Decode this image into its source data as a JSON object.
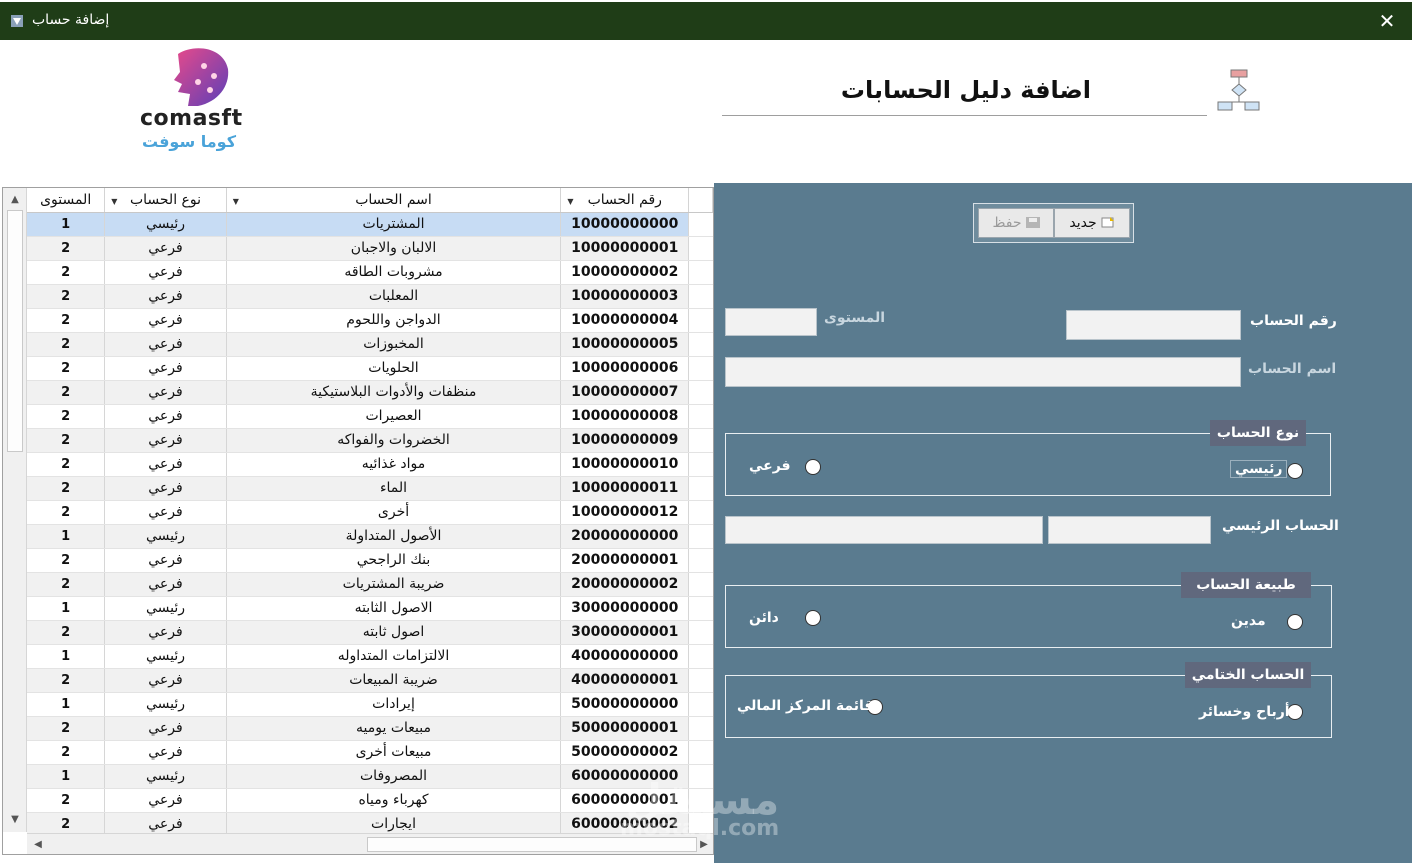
{
  "window": {
    "title": "إضافة حساب",
    "close_glyph": "✕"
  },
  "header": {
    "title": "اضافة دليل الحسابات",
    "logo_en": "comasft",
    "logo_ar": "كوما سوفت"
  },
  "toolbar": {
    "new_label": "جديد",
    "save_label": "حفظ"
  },
  "form": {
    "account_number_label": "رقم الحساب",
    "account_name_label": "اسم الحساب",
    "level_label": "المستوى",
    "account_number_value": "",
    "account_name_value": "",
    "level_value": "",
    "account_type": {
      "legend": "نوع الحساب",
      "option_main": "رئيسي",
      "option_sub": "فرعي"
    },
    "parent_account_label": "الحساب الرئيسي",
    "parent_account_code": "",
    "parent_account_name": "",
    "nature": {
      "legend": "طبيعة الحساب",
      "option_debit": "مدين",
      "option_credit": "دائن"
    },
    "final_account": {
      "legend": "الحساب الختامي",
      "option_pl": "أرباح وخسائر",
      "option_bs": "قائمة المركز المالي"
    }
  },
  "grid": {
    "columns": {
      "level": "المستوى",
      "type": "نوع الحساب",
      "name": "اسم الحساب",
      "number": "رقم الحساب"
    },
    "rows": [
      {
        "level": "1",
        "type": "رئيسي",
        "name": "المشتريات",
        "number": "10000000000"
      },
      {
        "level": "2",
        "type": "فرعي",
        "name": "الالبان والاجبان",
        "number": "10000000001"
      },
      {
        "level": "2",
        "type": "فرعي",
        "name": "مشروبات الطاقه",
        "number": "10000000002"
      },
      {
        "level": "2",
        "type": "فرعي",
        "name": "المعلبات",
        "number": "10000000003"
      },
      {
        "level": "2",
        "type": "فرعي",
        "name": "الدواجن واللحوم",
        "number": "10000000004"
      },
      {
        "level": "2",
        "type": "فرعي",
        "name": "المخبوزات",
        "number": "10000000005"
      },
      {
        "level": "2",
        "type": "فرعي",
        "name": "الحلويات",
        "number": "10000000006"
      },
      {
        "level": "2",
        "type": "فرعي",
        "name": "منظفات والأدوات البلاستيكية",
        "number": "10000000007"
      },
      {
        "level": "2",
        "type": "فرعي",
        "name": "العصيرات",
        "number": "10000000008"
      },
      {
        "level": "2",
        "type": "فرعي",
        "name": "الخضروات والفواكه",
        "number": "10000000009"
      },
      {
        "level": "2",
        "type": "فرعي",
        "name": "مواد غذائيه",
        "number": "10000000010"
      },
      {
        "level": "2",
        "type": "فرعي",
        "name": "الماء",
        "number": "10000000011"
      },
      {
        "level": "2",
        "type": "فرعي",
        "name": "أخرى",
        "number": "10000000012"
      },
      {
        "level": "1",
        "type": "رئيسي",
        "name": "الأصول المتداولة",
        "number": "20000000000"
      },
      {
        "level": "2",
        "type": "فرعي",
        "name": "بنك الراجحي",
        "number": "20000000001"
      },
      {
        "level": "2",
        "type": "فرعي",
        "name": "ضريبة المشتريات",
        "number": "20000000002"
      },
      {
        "level": "1",
        "type": "رئيسي",
        "name": "الاصول الثابته",
        "number": "30000000000"
      },
      {
        "level": "2",
        "type": "فرعي",
        "name": "اصول ثابته",
        "number": "30000000001"
      },
      {
        "level": "1",
        "type": "رئيسي",
        "name": "الالتزامات المتداوله",
        "number": "40000000000"
      },
      {
        "level": "2",
        "type": "فرعي",
        "name": "ضريبة المبيعات",
        "number": "40000000001"
      },
      {
        "level": "1",
        "type": "رئيسي",
        "name": "إيرادات",
        "number": "50000000000"
      },
      {
        "level": "2",
        "type": "فرعي",
        "name": "مبيعات يوميه",
        "number": "50000000001"
      },
      {
        "level": "2",
        "type": "فرعي",
        "name": "مبيعات أخرى",
        "number": "50000000002"
      },
      {
        "level": "1",
        "type": "رئيسي",
        "name": "المصروفات",
        "number": "60000000000"
      },
      {
        "level": "2",
        "type": "فرعي",
        "name": "كهرباء ومياه",
        "number": "60000000001"
      },
      {
        "level": "2",
        "type": "فرعي",
        "name": "ايجارات",
        "number": "60000000002"
      }
    ],
    "selected_row": 0
  },
  "watermark": {
    "text_ar": "مستقل",
    "text_en": "mostaql.com"
  },
  "colors": {
    "titlebar": "#1f3d17",
    "panel": "#5a7b8f",
    "legend": "#60687d",
    "selected_row": "#c7dcf4"
  },
  "icons": {
    "app": "app-icon",
    "header": "flowchart-icon",
    "new": "new-doc-icon",
    "save": "save-icon"
  }
}
